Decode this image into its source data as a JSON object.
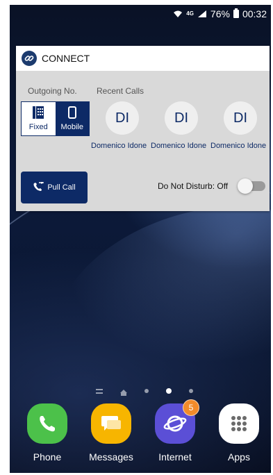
{
  "status_bar": {
    "battery": "76%",
    "time": "00:32",
    "network": "4G"
  },
  "widget": {
    "title": "CONNECT",
    "outgoing_label": "Outgoing No.",
    "recent_label": "Recent Calls",
    "toggle": {
      "fixed": "Fixed",
      "mobile": "Mobile",
      "selected": "Mobile"
    },
    "recent_calls": [
      {
        "initials": "DI",
        "name": "Domenico Idone"
      },
      {
        "initials": "DI",
        "name": "Domenico Idone"
      },
      {
        "initials": "DI",
        "name": "Domenico Idone"
      }
    ],
    "pull_call_label": "Pull Call",
    "dnd_label": "Do Not Disturb: Off",
    "dnd_state": "off"
  },
  "dock": {
    "apps": [
      {
        "label": "Phone",
        "icon": "phone-icon",
        "color": "#4cc14a"
      },
      {
        "label": "Messages",
        "icon": "messages-icon",
        "color": "#f7b500"
      },
      {
        "label": "Internet",
        "icon": "internet-icon",
        "color": "#5b4fd6",
        "badge": "5"
      },
      {
        "label": "Apps",
        "icon": "apps-grid-icon",
        "color": "#ffffff"
      }
    ]
  },
  "colors": {
    "accent": "#0d2a66",
    "badge": "#f28b2a"
  }
}
